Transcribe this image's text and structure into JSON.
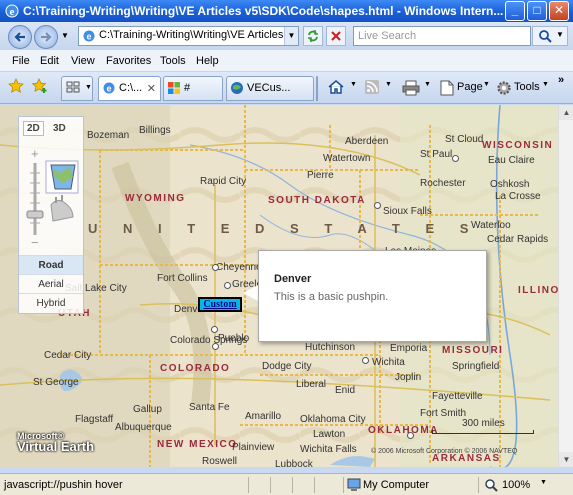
{
  "window": {
    "title": "C:\\Training-Writing\\Writing\\VE Articles v5\\SDK\\Code\\shapes.html - Windows Intern...",
    "minimize_glyph": "_",
    "maximize_glyph": "□",
    "close_glyph": "✕"
  },
  "address_bar": {
    "url": "C:\\Training-Writing\\Writing\\VE Articles v5\\",
    "search_placeholder": "Live Search"
  },
  "menu": [
    "File",
    "Edit",
    "View",
    "Favorites",
    "Tools",
    "Help"
  ],
  "tabs": [
    {
      "label": "C:\\...",
      "active": true
    },
    {
      "label": "#",
      "active": false
    },
    {
      "label": "VECus...",
      "active": false
    }
  ],
  "toolbar": {
    "page_label": "Page",
    "tools_label": "Tools",
    "overflow": "»"
  },
  "nav_control": {
    "dim_2d": "2D",
    "dim_3d": "3D",
    "modes": [
      "Road",
      "Aerial",
      "Hybrid"
    ],
    "selected_mode": "Road"
  },
  "map": {
    "country_label": "U N I T E D   S T A T E S",
    "states": [
      "WYOMING",
      "SOUTH DAKOTA",
      "WISCONSIN",
      "MISSOURI",
      "COLORADO",
      "NEW MEXICO",
      "OKLAHOMA",
      "ARKANSAS",
      "ILLINOIS",
      "UTAH"
    ],
    "cities": [
      "Bozeman",
      "Billings",
      "Aberdeen",
      "St Cloud",
      "Watertown",
      "St Paul",
      "Eau Claire",
      "Pierre",
      "Rapid City",
      "Rochester",
      "Oshkosh",
      "La Crosse",
      "Sioux Falls",
      "Waterloo",
      "Cedar Rapids",
      "Salt Lake City",
      "Fort Collins",
      "Greeley",
      "Cheyenne",
      "Denver",
      "Colorado Springs",
      "Pueblo",
      "Hutchinson",
      "Emporia",
      "Wichita",
      "Dodge City",
      "Joplin",
      "Springfield",
      "Cedar City",
      "St George",
      "Flagstaff",
      "Gallup",
      "Santa Fe",
      "Amarillo",
      "Albuquerque",
      "Oklahoma City",
      "Lawton",
      "Fort Smith",
      "Fayetteville",
      "Plainview",
      "Wichita Falls",
      "Roswell",
      "Lubbock",
      "Liberal",
      "Enid",
      "Los Moines"
    ],
    "scale_label": "300 miles",
    "copyright": "© 2006 Microsoft Corporation  © 2006 NAVTEQ",
    "brand_line1": "Microsoft®",
    "brand_line2": "Virtual Earth"
  },
  "pushpin": {
    "label": "Custom",
    "popup_title": "Denver",
    "popup_description": "This is a basic pushpin."
  },
  "status": {
    "text": "javascript://pushin hover",
    "zone": "My Computer",
    "zoom": "100%"
  }
}
